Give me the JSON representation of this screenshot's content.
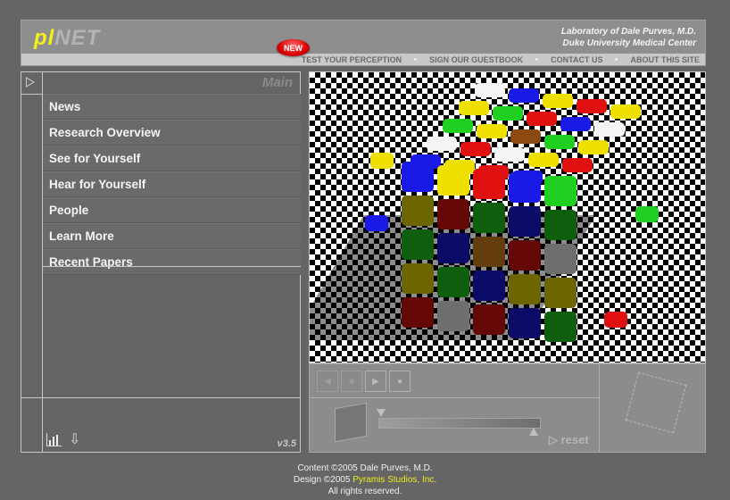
{
  "header": {
    "logo_prefix": "pl",
    "logo_suffix": "NET",
    "lab_line1": "Laboratory of Dale Purves, M.D.",
    "lab_line2": "Duke University Medical Center",
    "new_badge": "NEW",
    "nav": [
      "TEST YOUR PERCEPTION",
      "SIGN OUR GUESTBOOK",
      "CONTACT US",
      "ABOUT THIS SITE"
    ]
  },
  "sidebar": {
    "section_title": "Main",
    "items": [
      {
        "label": "News"
      },
      {
        "label": "Research Overview"
      },
      {
        "label": "See for Yourself"
      },
      {
        "label": "Hear for Yourself"
      },
      {
        "label": "People"
      },
      {
        "label": "Learn More"
      },
      {
        "label": "Recent Papers"
      }
    ],
    "version": "v3.5",
    "icons": [
      "bar-chart-icon",
      "download-arrow-icon"
    ]
  },
  "viewer": {
    "image_description": "5x5 colored cube illusion on checkerboard floor",
    "controls": [
      "rewind",
      "stop",
      "play",
      "record"
    ],
    "reset_label": "reset",
    "slider_value": 0
  },
  "footer": {
    "line1": "Content ©2005 Dale Purves, M.D.",
    "line2_prefix": "Design ©2005 ",
    "line2_link": "Pyramis Studios, Inc.",
    "line3": "All rights reserved."
  },
  "colors": {
    "background": "#656565",
    "logo_accent": "#f2f21a",
    "link_yellow": "#ecec1e",
    "new_badge": "#d80000"
  }
}
